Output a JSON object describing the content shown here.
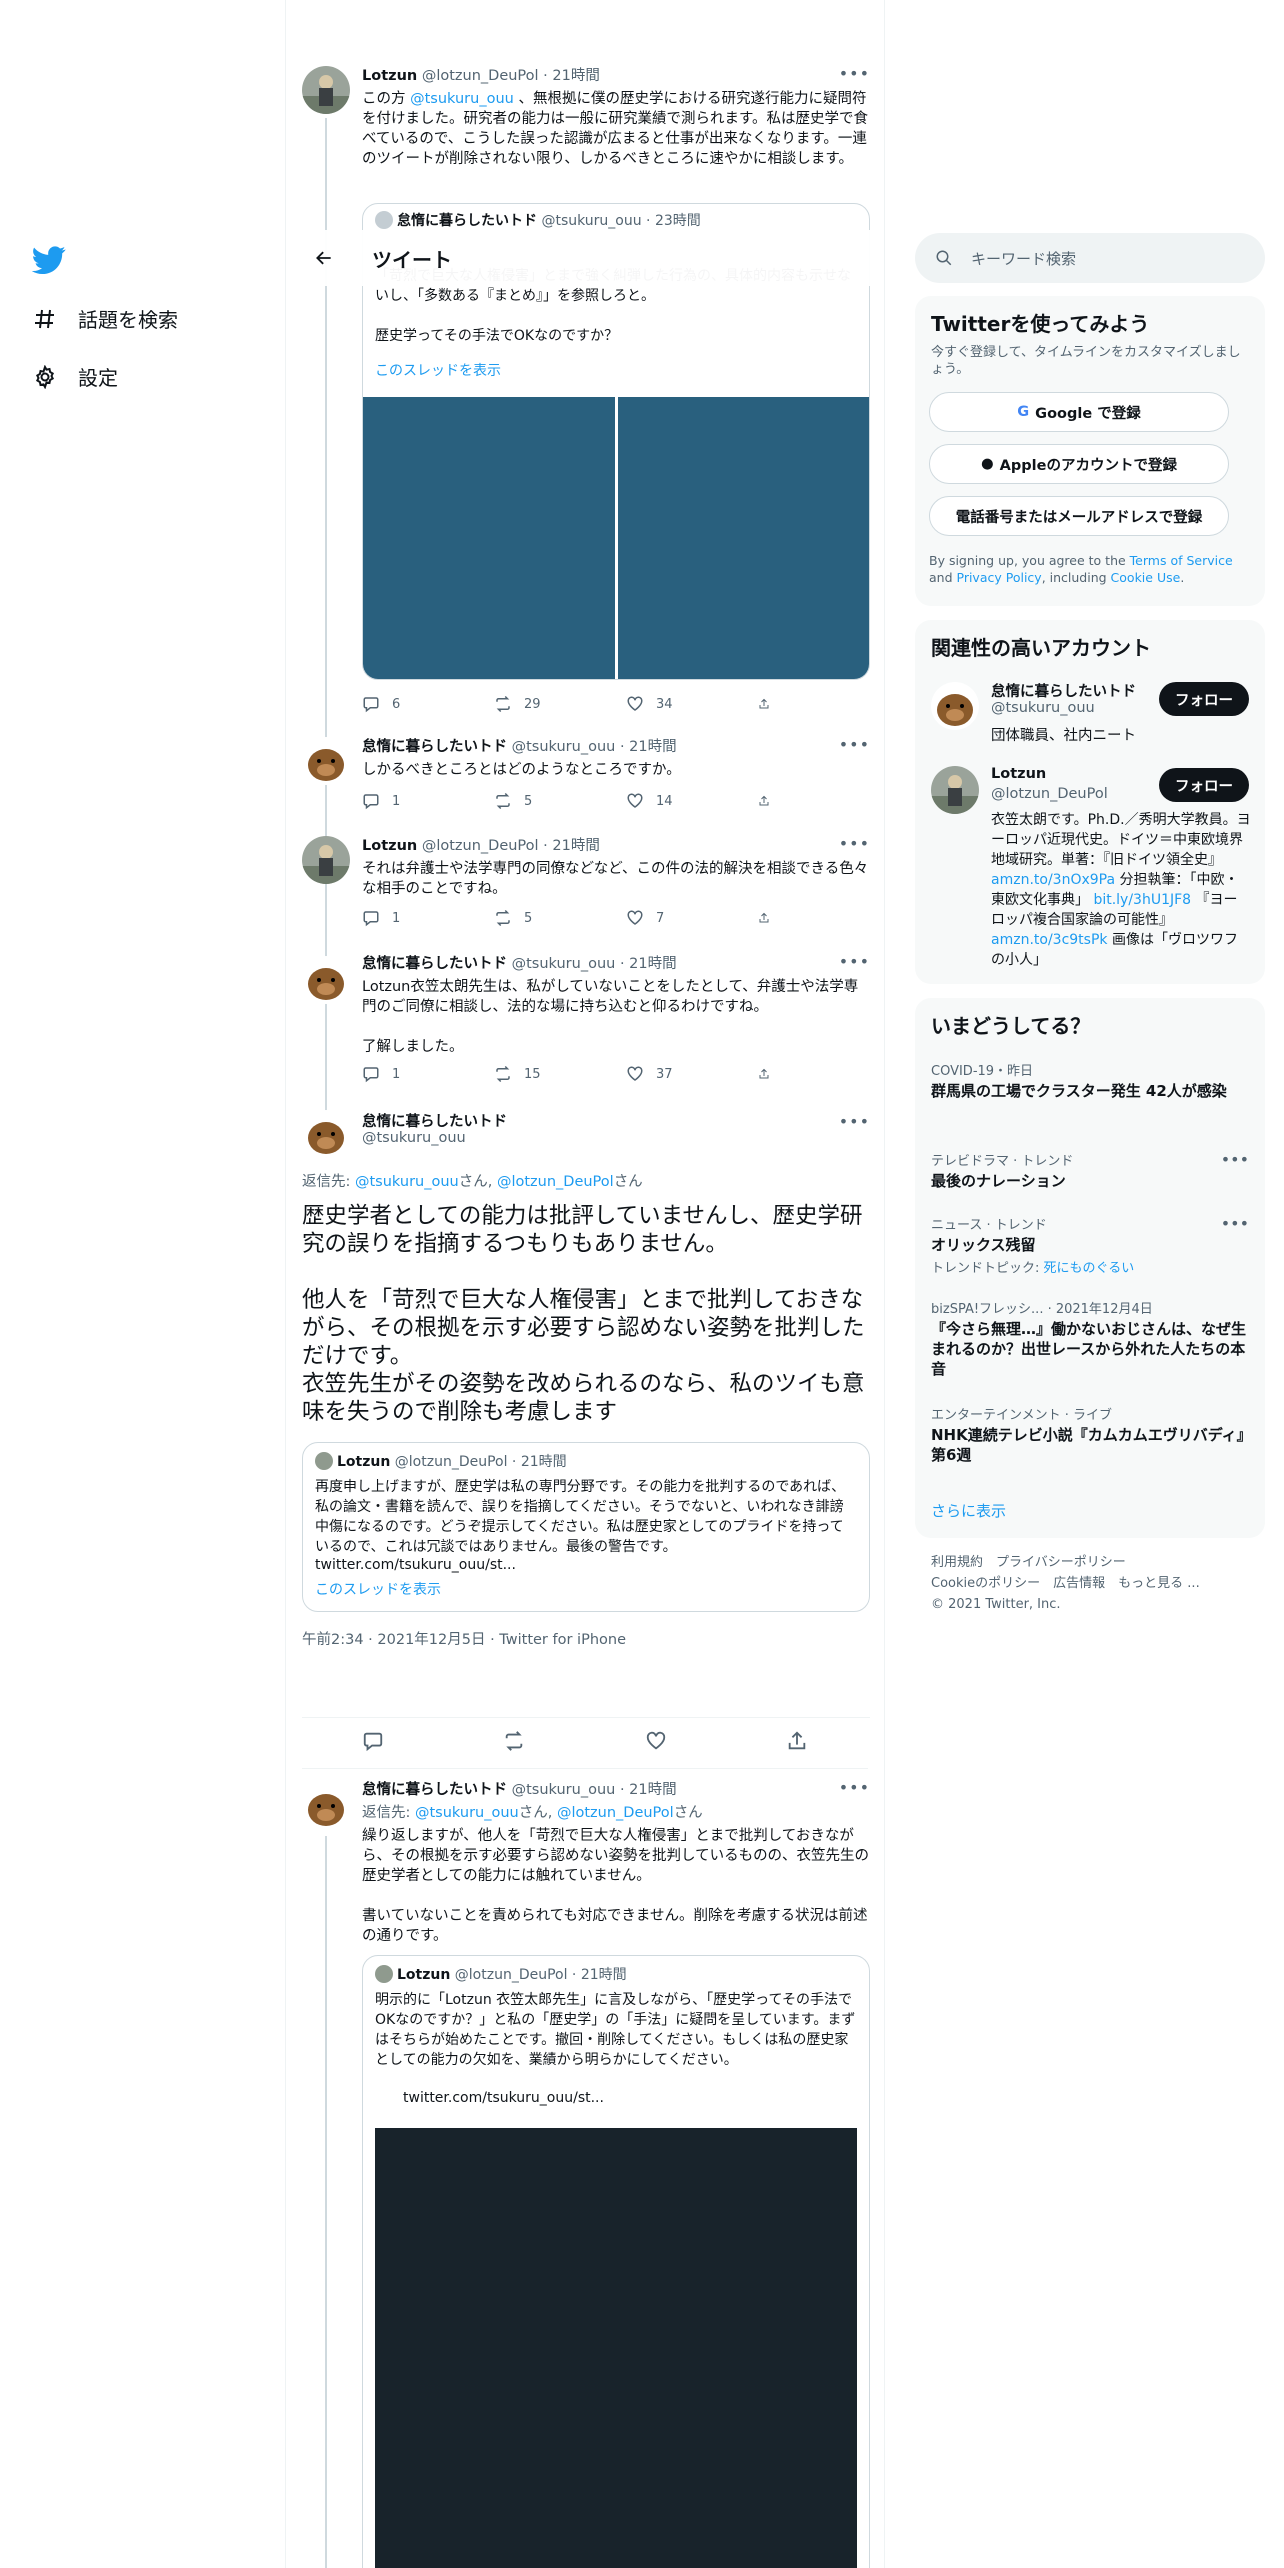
{
  "nav": {
    "topics": "話題を検索",
    "settings": "設定"
  },
  "header": {
    "title": "ツイート"
  },
  "tweets": [
    {
      "name": "Lotzun",
      "handle": "@lotzun_DeuPol · 21時間",
      "text_pre": "この方 ",
      "mention": "@tsukuru_ouu",
      "text_post": " 、無根拠に僕の歴史学における研究遂行能力に疑問符を付けました。研究者の能力は一般に研究業績で測られます。私は歴史学で食べているので、こうした誤った認識が広まると仕事が出来なくなります。一連のツイートが削除されない限り、しかるべきところに速やかに相談します。"
    },
    {
      "name": "Lotzun",
      "handle": "@lotzun_DeuPol · 21時間",
      "text": "それは弁護士や法学専門の同僚などなど、この件の法的解決を相談できる色々な相手のことですね。",
      "reply": "1",
      "retweet": "5",
      "like": "7"
    },
    {
      "name": "怠惰に暮らしたいトド",
      "handle": "@tsukuru_ouu · 21時間",
      "text": "しかるべきところとはどのようなところですか。",
      "reply": "1",
      "retweet": "5",
      "like": "14"
    },
    {
      "name": "怠惰に暮らしたいトド",
      "handle": "@tsukuru_ouu · 21時間",
      "text": "Lotzun衣笠太朗先生は、私がしていないことをしたとして、弁護士や法学専門のご同僚に相談し、法的な場に持ち込むと仰るわけですね。\n\n了解しました。",
      "reply": "1",
      "retweet": "15",
      "like": "37"
    }
  ],
  "quoted1": {
    "name": "怠惰に暮らしたいトド",
    "handle": "@tsukuru_ouu · 23時間",
    "text": "「苛烈で巨大な人権侵害」とまで強く糾弾した行為の、具体的内容も示せないし、「多数ある『まとめ』」を参照しろと。\n\n歴史学ってその手法でOKなのですか？",
    "show_thread": "このスレッドを表示",
    "reply": "6",
    "retweet": "29",
    "like": "34"
  },
  "main": {
    "name": "怠惰に暮らしたいトド",
    "handle": "@tsukuru_ouu",
    "reply_to_label": "返信先: ",
    "reply_to_1": "@tsukuru_ouu",
    "reply_to_mid": "さん, ",
    "reply_to_2": "@lotzun_DeuPol",
    "reply_to_end": "さん",
    "text": "歴史学者としての能力は批評していませんし、歴史学研究の誤りを指摘するつもりもありません。\n\n他人を「苛烈で巨大な人権侵害」とまで批判しておきながら、その根拠を示す必要すら認めない姿勢を批判しただけです。\n衣笠先生がその姿勢を改められるのなら、私のツイも意味を失うので削除も考慮します",
    "timestamp": "午前2:34 · 2021年12月5日 · Twitter for iPhone"
  },
  "quoted2": {
    "name": "Lotzun",
    "handle": "@lotzun_DeuPol · 21時間",
    "text": "再度申し上げますが、歴史学は私の専門分野です。その能力を批判するのであれば、私の論文・書籍を読んで、誤りを指摘してください。そうでないと、いわれなき誹謗中傷になるのです。どうぞ提示してください。私は歴史家としてのプライドを持っているので、これは冗談ではありません。最後の警告です。",
    "url": "twitter.com/tsukuru_ouu/st...",
    "show_thread": "このスレッドを表示"
  },
  "reply_tweet": {
    "name": "怠惰に暮らしたいトド",
    "handle": "@tsukuru_ouu · 21時間",
    "reply_to_label": "返信先: ",
    "reply_to_1": "@tsukuru_ouu",
    "reply_to_mid": "さん, ",
    "reply_to_2": "@lotzun_DeuPol",
    "reply_to_end": "さん",
    "text": "繰り返しますが、他人を「苛烈で巨大な人権侵害」とまで批判しておきながら、その根拠を示す必要すら認めない姿勢を批判しているものの、衣笠先生の歴史学者としての能力には触れていません。\n\n書いていないことを責められても対応できません。削除を考慮する状況は前述の通りです。"
  },
  "quoted3": {
    "name": "Lotzun",
    "handle": "@lotzun_DeuPol · 21時間",
    "text": "明示的に「Lotzun 衣笠太郎先生」に言及しながら、「歴史学ってその手法でOKなのですか？」と私の「歴史学」の「手法」に疑問を呈しています。まずはそちらが始めたことです。撤回・削除してください。もしくは私の歴史家としての能力の欠如を、業績から明らかにしてください。",
    "url": "twitter.com/tsukuru_ouu/st..."
  },
  "search": {
    "placeholder": "キーワード検索"
  },
  "signup": {
    "title": "Twitterを使ってみよう",
    "desc": "今すぐ登録して、タイムラインをカスタマイズしましょう。",
    "google": "Google で登録",
    "apple": "Appleのアカウントで登録",
    "phone": "電話番号またはメールアドレスで登録",
    "terms_pre": "By signing up, you agree to the ",
    "terms": "Terms of Service",
    "and": " and ",
    "privacy": "Privacy Policy",
    "including": ", including ",
    "cookie": "Cookie Use",
    "end": "."
  },
  "related": {
    "title": "関連性の高いアカウント",
    "follow": "フォロー",
    "accounts": [
      {
        "name": "怠惰に暮らしたいトド",
        "handle": "@tsukuru_ouu",
        "bio": "団体職員、社内ニート"
      },
      {
        "name": "Lotzun",
        "handle": "@lotzun_DeuPol",
        "bio1": "衣笠太朗です。Ph.D.／秀明大学教員。ヨーロッパ近現代史。ドイツ＝中東欧境界地域研究。単著：『旧ドイツ領全史』 ",
        "link1": "amzn.to/3nOx9Pa",
        "bio2": " 分担執筆：「中欧・東欧文化事典」 ",
        "link2": "bit.ly/3hU1JF8",
        "bio3": " 『ヨーロッパ複合国家論の可能性』 ",
        "link3": "amzn.to/3c9tsPk",
        "bio4": " 画像は「ヴロツワフの小人」"
      }
    ]
  },
  "trends": {
    "title": "いまどうしてる？",
    "items": [
      {
        "meta": "COVID-19・昨日",
        "name": "群馬県の工場でクラスター発生 42人が感染"
      },
      {
        "meta": "テレビドラマ · トレンド",
        "name": "最後のナレーション"
      },
      {
        "meta": "ニュース · トレンド",
        "name": "オリックス残留",
        "sub_pre": "トレンドトピック: ",
        "sub_link": "死にものぐるい"
      },
      {
        "meta": "bizSPA!フレッシ... · 2021年12月4日",
        "name": "『今さら無理…』働かないおじさんは、なぜ生まれるのか？出世レースから外れた人たちの本音"
      },
      {
        "meta": "エンターテインメント · ライブ",
        "name": "NHK連続テレビ小説『カムカムエヴリバディ』第6週"
      }
    ],
    "more": "さらに表示"
  },
  "footer": {
    "terms": "利用規約",
    "privacy": "プライバシーポリシー",
    "cookie": "Cookieのポリシー",
    "ads": "広告情報",
    "more": "もっと見る ...",
    "copy": "© 2021 Twitter, Inc."
  }
}
